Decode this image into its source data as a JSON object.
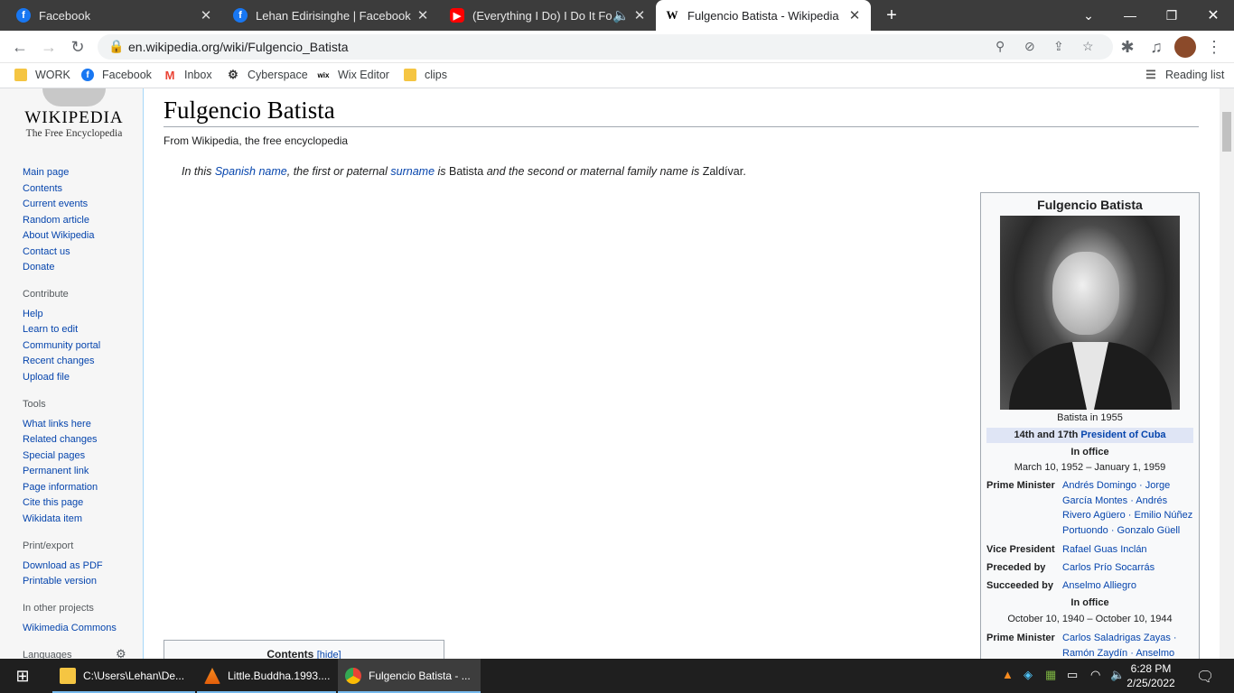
{
  "browser": {
    "tabs": [
      {
        "title": "Facebook",
        "icon": "facebook-icon"
      },
      {
        "title": "Lehan Edirisinghe | Facebook",
        "icon": "facebook-icon"
      },
      {
        "title": "(Everything I Do) I Do It For Y",
        "icon": "youtube-icon"
      },
      {
        "title": "Fulgencio Batista - Wikipedia",
        "icon": "wikipedia-icon"
      }
    ],
    "new_tab": "+",
    "url": "en.wikipedia.org/wiki/Fulgencio_Batista",
    "bookmarks": [
      {
        "label": "WORK",
        "icon": "folder-icon"
      },
      {
        "label": "Facebook",
        "icon": "facebook-icon"
      },
      {
        "label": "Inbox",
        "icon": "gmail-icon"
      },
      {
        "label": "Cyberspace",
        "icon": "cyberspace-icon"
      },
      {
        "label": "Wix Editor",
        "icon": "wix-icon"
      },
      {
        "label": "clips",
        "icon": "folder-icon"
      }
    ],
    "reading_list": "Reading list"
  },
  "wiki": {
    "logo_word": "WIKIPEDIA",
    "logo_tag": "The Free Encyclopedia",
    "nav": [
      "Main page",
      "Contents",
      "Current events",
      "Random article",
      "About Wikipedia",
      "Contact us",
      "Donate"
    ],
    "contribute_heading": "Contribute",
    "contribute": [
      "Help",
      "Learn to edit",
      "Community portal",
      "Recent changes",
      "Upload file"
    ],
    "tools_heading": "Tools",
    "tools": [
      "What links here",
      "Related changes",
      "Special pages",
      "Permanent link",
      "Page information",
      "Cite this page",
      "Wikidata item"
    ],
    "print_heading": "Print/export",
    "print": [
      "Download as PDF",
      "Printable version"
    ],
    "projects_heading": "In other projects",
    "projects": [
      "Wikimedia Commons"
    ],
    "languages_heading": "Languages"
  },
  "article": {
    "title": "Fulgencio Batista",
    "from": "From Wikipedia, the free encyclopedia",
    "hatnote": {
      "a": "In this ",
      "link1": "Spanish name",
      "b": ", the first or paternal ",
      "link2": "surname",
      "c": " is ",
      "d": "Batista",
      "e": " and the second or maternal family name is ",
      "f": "Zaldívar",
      "g": "."
    },
    "toc_label": "Contents",
    "toc_hide": "[hide]"
  },
  "infobox": {
    "title": "Fulgencio Batista",
    "caption": "Batista in 1955",
    "office_prefix": "14th and 17th ",
    "office_link": "President of Cuba",
    "in_office_1": "In office",
    "term_1": "March 10, 1952 – January 1, 1959",
    "pm_label": "Prime Minister",
    "pm_1": "Andrés Domingo · Jorge García Montes · Andrés Rivero Agüero · Emilio Núñez Portuondo · Gonzalo Güell",
    "vp_label": "Vice President",
    "vp": "Rafael Guas Inclán",
    "preceded_label": "Preceded by",
    "preceded": "Carlos Prío Socarrás",
    "succeeded_label": "Succeeded by",
    "succeeded": "Anselmo Alliegro",
    "in_office_2": "In office",
    "term_2": "October 10, 1940 – October 10, 1944",
    "pm_2": "Carlos Saladrigas Zayas · Ramón Zaydín · Anselmo"
  },
  "taskbar": {
    "items": [
      {
        "label": "C:\\Users\\Lehan\\De...",
        "icon": "folder-icon"
      },
      {
        "label": "Little.Buddha.1993....",
        "icon": "vlc-icon"
      },
      {
        "label": "Fulgencio Batista - ...",
        "icon": "chrome-icon"
      }
    ],
    "time": "6:28 PM",
    "date": "2/25/2022"
  }
}
